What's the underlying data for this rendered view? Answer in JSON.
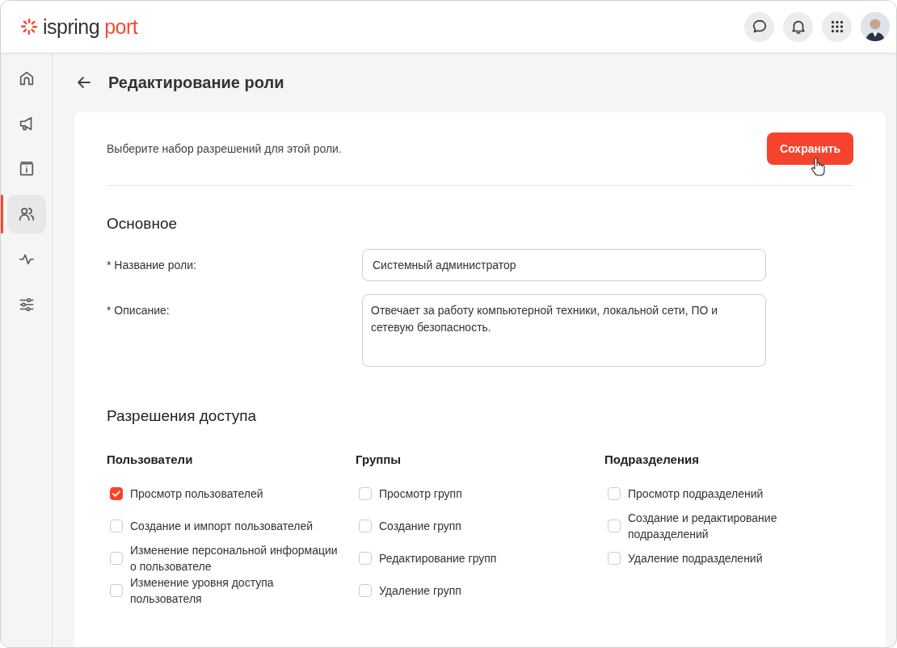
{
  "logo": {
    "name": "ispring",
    "product": "port"
  },
  "header_actions": [
    {
      "kind": "chat"
    },
    {
      "kind": "bell"
    },
    {
      "kind": "apps"
    },
    {
      "kind": "avatar"
    }
  ],
  "sidebar": {
    "items": [
      {
        "kind": "home",
        "selected": false
      },
      {
        "kind": "megaphone",
        "selected": false
      },
      {
        "kind": "info",
        "selected": false
      },
      {
        "kind": "users",
        "selected": true
      },
      {
        "kind": "activity",
        "selected": false
      },
      {
        "kind": "sliders",
        "selected": false
      }
    ]
  },
  "page": {
    "title": "Редактирование роли"
  },
  "intro": "Выберите набор разрешений для этой роли.",
  "save_button": "Сохранить",
  "basic": {
    "title": "Основное",
    "fields": [
      {
        "kind": "input",
        "label": "* Название роли:",
        "value": "Системный администратор"
      },
      {
        "kind": "textarea",
        "label": "* Описание:",
        "value": "Отвечает за работу компьютерной техники, локальной сети, ПО и сетевую безопасность."
      }
    ]
  },
  "permissions": {
    "title": "Разрешения доступа",
    "groups": [
      {
        "title": "Пользователи",
        "items": [
          {
            "label": "Просмотр пользователей",
            "checked": true
          },
          {
            "label": "Создание и импорт пользователей",
            "checked": false
          },
          {
            "label": "Изменение персональной информации о пользователе",
            "checked": false
          },
          {
            "label": "Изменение уровня доступа пользователя",
            "checked": false
          }
        ]
      },
      {
        "title": "Группы",
        "items": [
          {
            "label": "Просмотр групп",
            "checked": false
          },
          {
            "label": "Создание групп",
            "checked": false
          },
          {
            "label": "Редактирование групп",
            "checked": false
          },
          {
            "label": "Удаление групп",
            "checked": false
          }
        ]
      },
      {
        "title": "Подразделения",
        "items": [
          {
            "label": "Просмотр подразделений",
            "checked": false
          },
          {
            "label": "Создание и редактирование подразделений",
            "checked": false
          },
          {
            "label": "Удаление подразделений",
            "checked": false
          }
        ]
      }
    ]
  }
}
